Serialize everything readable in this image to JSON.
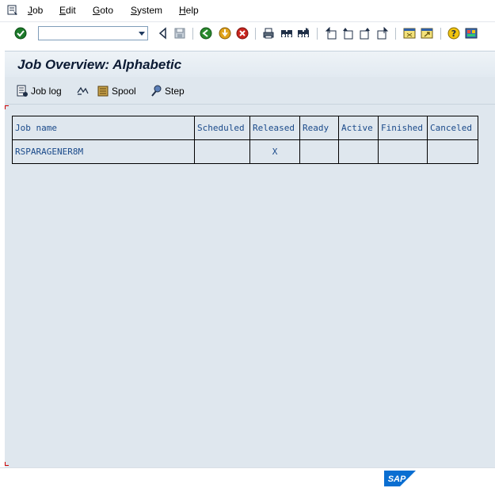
{
  "menu": {
    "items": [
      "Job",
      "Edit",
      "Goto",
      "System",
      "Help"
    ]
  },
  "toolbar": {
    "command_field_value": "",
    "icons": [
      "enter-icon",
      "back-icon",
      "save-icon",
      "green-back-icon",
      "exit-icon",
      "cancel-icon",
      "print-icon",
      "find-icon",
      "find-next-icon",
      "first-page-icon",
      "previous-page-icon",
      "next-page-icon",
      "last-page-icon",
      "create-session-icon",
      "shortcut-icon",
      "help-icon",
      "layout-icon"
    ]
  },
  "page": {
    "title": "Job Overview: Alphabetic"
  },
  "app_toolbar": {
    "job_log": "Job log",
    "spool": "Spool",
    "step": "Step"
  },
  "table": {
    "headers": [
      "Job name",
      "Scheduled",
      "Released",
      "Ready",
      "Active",
      "Finished",
      "Canceled"
    ],
    "rows": [
      [
        "RSPARAGENER8M",
        "",
        "X",
        "",
        "",
        "",
        ""
      ]
    ]
  },
  "colors": {
    "background": "#dfe7ee",
    "table_text": "#1a4a8a",
    "sap_logo_blue": "#0a6ed1"
  },
  "status": {
    "logo_text": "SAP"
  }
}
